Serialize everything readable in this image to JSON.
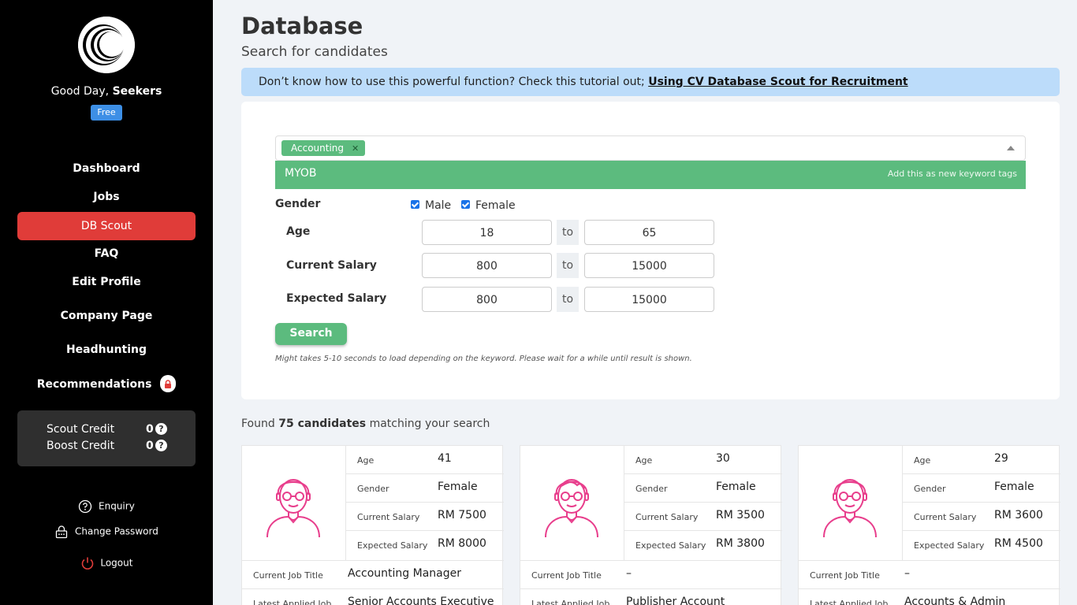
{
  "sidebar": {
    "greeting_prefix": "Good Day,",
    "user_name": "Seekers",
    "plan": "Free",
    "nav": [
      {
        "label": "Dashboard"
      },
      {
        "label": "Jobs"
      },
      {
        "label": "DB Scout"
      },
      {
        "label": "FAQ"
      },
      {
        "label": "Edit Profile"
      },
      {
        "label": "Company Page"
      },
      {
        "label": "Headhunting"
      },
      {
        "label": "Recommendations"
      }
    ],
    "credits": {
      "scout_label": "Scout Credit",
      "scout_value": "0",
      "boost_label": "Boost Credit",
      "boost_value": "0"
    },
    "links": {
      "enquiry": "Enquiry",
      "change_password": "Change Password",
      "logout": "Logout"
    }
  },
  "header": {
    "title": "Database",
    "subtitle": "Search for candidates"
  },
  "tutorial": {
    "text": "Don’t know how to use this powerful function? Check this tutorial out;",
    "link": "Using CV Database Scout for Recruitment"
  },
  "search": {
    "tags": [
      "Accounting"
    ],
    "suggestion": {
      "keyword": "MYOB",
      "hint": "Add this as new keyword tags"
    },
    "gender": {
      "label": "Gender",
      "options": [
        {
          "label": "Male",
          "checked": true
        },
        {
          "label": "Female",
          "checked": true
        }
      ]
    },
    "age": {
      "label": "Age",
      "min": "18",
      "max": "65"
    },
    "current_salary": {
      "label": "Current Salary",
      "min": "800",
      "max": "15000"
    },
    "expected_salary": {
      "label": "Expected Salary",
      "min": "800",
      "max": "15000"
    },
    "to_label": "to",
    "button": "Search",
    "note": "Might takes 5-10 seconds to load depending on the keyword. Please wait for a while until result is shown."
  },
  "results": {
    "prefix": "Found",
    "count_text": "75 candidates",
    "suffix": "matching your search",
    "field_labels": {
      "age": "Age",
      "gender": "Gender",
      "current_salary": "Current Salary",
      "expected_salary": "Expected Salary",
      "current_job": "Current Job Title",
      "latest_job": "Latest Applied Job"
    },
    "candidates": [
      {
        "age": "41",
        "gender": "Female",
        "current_salary": "RM 7500",
        "expected_salary": "RM 8000",
        "current_job": "Accounting Manager",
        "latest_job": "Senior Accounts Executive"
      },
      {
        "age": "30",
        "gender": "Female",
        "current_salary": "RM 3500",
        "expected_salary": "RM 3800",
        "current_job": "–",
        "latest_job": "Publisher Account"
      },
      {
        "age": "29",
        "gender": "Female",
        "current_salary": "RM 3600",
        "expected_salary": "RM 4500",
        "current_job": "–",
        "latest_job": "Accounts & Admin"
      }
    ]
  },
  "colors": {
    "sidebar_bg": "#000000",
    "active_nav": "#e03c39",
    "accent_green": "#5cbb7e",
    "info_bar": "#bcdcfa",
    "avatar_pink": "#e83e8c"
  }
}
